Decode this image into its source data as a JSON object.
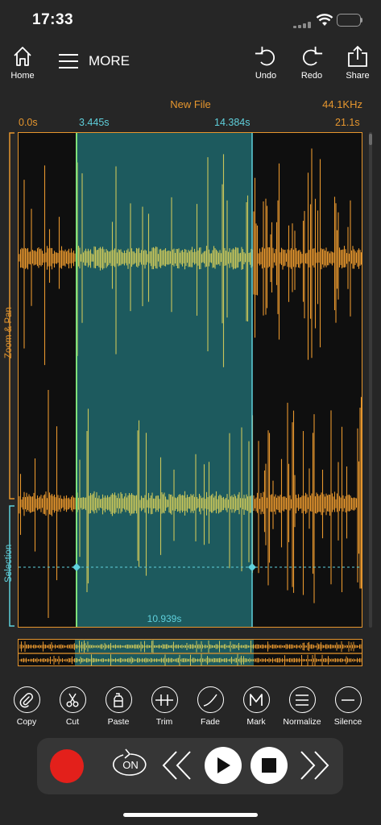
{
  "status_bar": {
    "time": "17:33",
    "signal_icon": "cellular-signal-icon",
    "wifi_icon": "wifi-icon",
    "battery_icon": "battery-icon"
  },
  "toolbar": {
    "home_label": "Home",
    "more_label": "MORE",
    "undo_label": "Undo",
    "redo_label": "Redo",
    "share_label": "Share"
  },
  "file": {
    "name": "New File",
    "sample_rate": "44.1KHz"
  },
  "timeline": {
    "start": "0.0s",
    "selection_start": "3.445s",
    "selection_end": "14.384s",
    "end": "21.1s",
    "selection_duration": "10.939s"
  },
  "selection_range": {
    "start_seconds": 3.445,
    "end_seconds": 14.384,
    "total_seconds": 21.1
  },
  "side_labels": {
    "zoom_pan": "Zoom & Pan",
    "selection": "Selection"
  },
  "tools": [
    {
      "label": "Copy",
      "icon": "paperclip-icon"
    },
    {
      "label": "Cut",
      "icon": "scissors-icon"
    },
    {
      "label": "Paste",
      "icon": "paste-bottle-icon"
    },
    {
      "label": "Trim",
      "icon": "trim-icon"
    },
    {
      "label": "Fade",
      "icon": "fade-curve-icon"
    },
    {
      "label": "Mark",
      "icon": "mark-m-icon"
    },
    {
      "label": "Normalize",
      "icon": "normalize-icon"
    },
    {
      "label": "Silence",
      "icon": "silence-icon"
    }
  ],
  "transport": {
    "loop_label": "ON"
  },
  "colors": {
    "background": "#262626",
    "waveform": "#e6962e",
    "selection_fill": "#1d5a5e",
    "selection_wave": "#c9c55a",
    "selection_edge": "#7ee07a",
    "cyan": "#5fd0dc",
    "record": "#e3201b"
  }
}
